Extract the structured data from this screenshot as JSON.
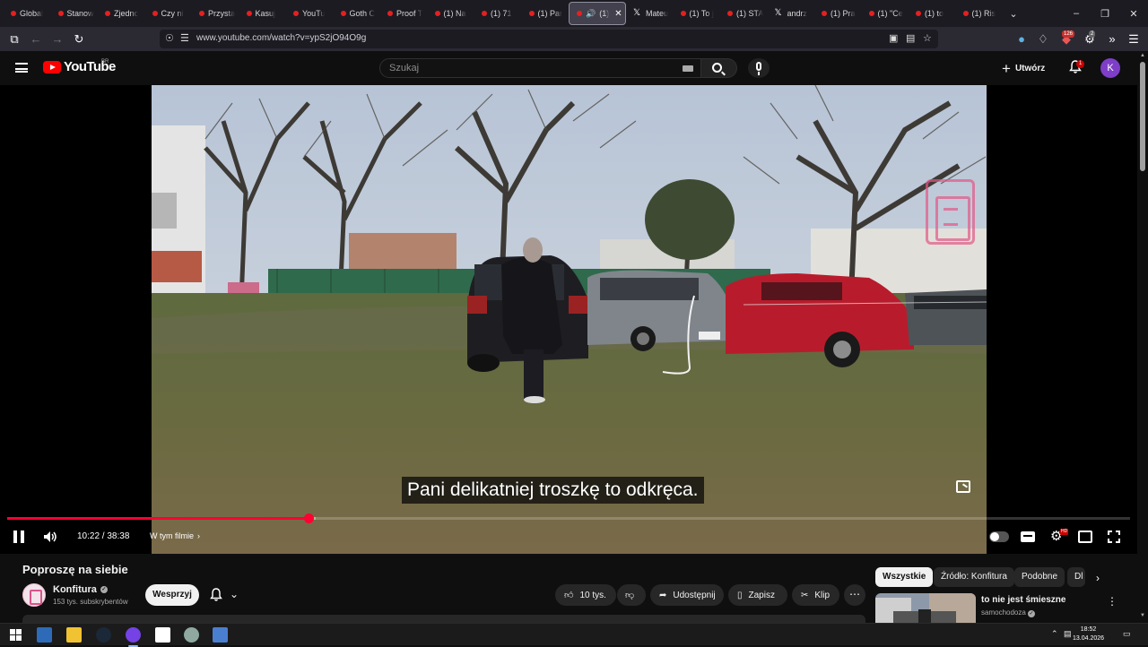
{
  "browser": {
    "tabs": [
      {
        "title": "Global",
        "icon": "youtube-favicon"
      },
      {
        "title": "Stanow",
        "icon": "youtube-favicon"
      },
      {
        "title": "Zjednc",
        "icon": "youtube-favicon"
      },
      {
        "title": "Czy ni",
        "icon": "youtube-favicon"
      },
      {
        "title": "Przysta",
        "icon": "youtube-favicon"
      },
      {
        "title": "Kasuj",
        "icon": "youtube-favicon"
      },
      {
        "title": "YouTu",
        "icon": "youtube-favicon"
      },
      {
        "title": "Goth C",
        "icon": "youtube-favicon"
      },
      {
        "title": "Proof T",
        "icon": "youtube-favicon"
      },
      {
        "title": "(1) Na",
        "icon": "youtube-favicon"
      },
      {
        "title": "(1) 71",
        "icon": "youtube-favicon"
      },
      {
        "title": "(1) Par",
        "icon": "youtube-favicon"
      }
    ],
    "active_tab": {
      "title": "(1)",
      "icon": "youtube-favicon"
    },
    "tabs_after": [
      {
        "title": "Mateu",
        "icon": "x-favicon"
      },
      {
        "title": "(1) To j",
        "icon": "youtube-favicon"
      },
      {
        "title": "(1) STA",
        "icon": "youtube-favicon"
      },
      {
        "title": "andrz",
        "icon": "x-favicon"
      },
      {
        "title": "(1) Pra",
        "icon": "youtube-favicon"
      },
      {
        "title": "(1) \"Ce",
        "icon": "youtube-favicon"
      },
      {
        "title": "(1) to",
        "icon": "youtube-favicon"
      },
      {
        "title": "(1) Ris",
        "icon": "youtube-favicon"
      }
    ],
    "url": "www.youtube.com/watch?v=ypS2jO94O9g",
    "extension_badge": "126",
    "extension_badge_2": "2"
  },
  "youtube": {
    "logo_text": "YouTube",
    "country_code": "BR",
    "search_placeholder": "Szukaj",
    "create_label": "Utwórz",
    "notifications_count": "1",
    "avatar_letter": "K",
    "accent_color": "#ff0000",
    "avatar_color": "#7e3ec7"
  },
  "player": {
    "subtitle": "Pani delikatniej troszkę to odkręca.",
    "current_time": "10:22",
    "duration": "38:38",
    "time_display": "10:22 / 38:38",
    "played_fraction": 0.268,
    "loaded_fraction": 0.275,
    "chapter_label": "W tym filmie",
    "progress_color": "#ff0033"
  },
  "video": {
    "title": "Poproszę na siebie",
    "channel_name": "Konfitura",
    "subscribers": "153 tys. subskrybentów",
    "join_label": "Wesprzyj",
    "likes": "10 tys.",
    "share_label": "Udostępnij",
    "save_label": "Zapisz",
    "clip_label": "Klip"
  },
  "sidebar": {
    "chips": [
      "Wszystkie",
      "Źródło: Konfitura",
      "Podobne",
      "Dl"
    ],
    "recommendation": {
      "title": "to nie jest śmieszne",
      "channel": "samochodoza"
    }
  },
  "taskbar": {
    "time": "18:52",
    "date": "13.04.2026",
    "apps": [
      "windows-start-icon",
      "taskview-icon",
      "file-explorer-icon",
      "steam-icon",
      "firefox-icon",
      "notion-icon",
      "app-icon",
      "calculator-icon"
    ]
  }
}
